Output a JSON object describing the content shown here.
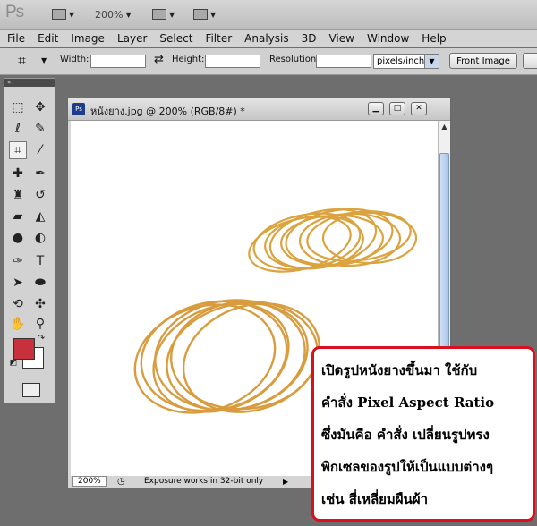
{
  "app": {
    "logo": "Ps",
    "zoom": "200%"
  },
  "menu": {
    "items": [
      "File",
      "Edit",
      "Image",
      "Layer",
      "Select",
      "Filter",
      "Analysis",
      "3D",
      "View",
      "Window",
      "Help"
    ]
  },
  "options": {
    "width_label": "Width:",
    "height_label": "Height:",
    "resolution_label": "Resolution:",
    "unit": "pixels/inch",
    "front_image": "Front Image"
  },
  "document": {
    "title": "หนังยาง.jpg @ 200% (RGB/8#) *",
    "icon_text": "Ps",
    "zoom": "200%",
    "status": "Exposure works in 32-bit only"
  },
  "colors": {
    "foreground": "#c8303c",
    "background": "#ffffff",
    "callout_border": "#d8101f"
  },
  "callout": {
    "lines": [
      "เปิดรูปหนังยางขึ้นมา ใช้กับ",
      "คำสั่ง Pixel Aspect Ratio",
      "ซึ่งมันคือ คำสั่ง เปลี่ยนรูปทรง",
      "พิกเซลของรูปให้เป็นแบบต่างๆ",
      "เช่น สี่เหลี่ยมผืนผ้า"
    ]
  }
}
